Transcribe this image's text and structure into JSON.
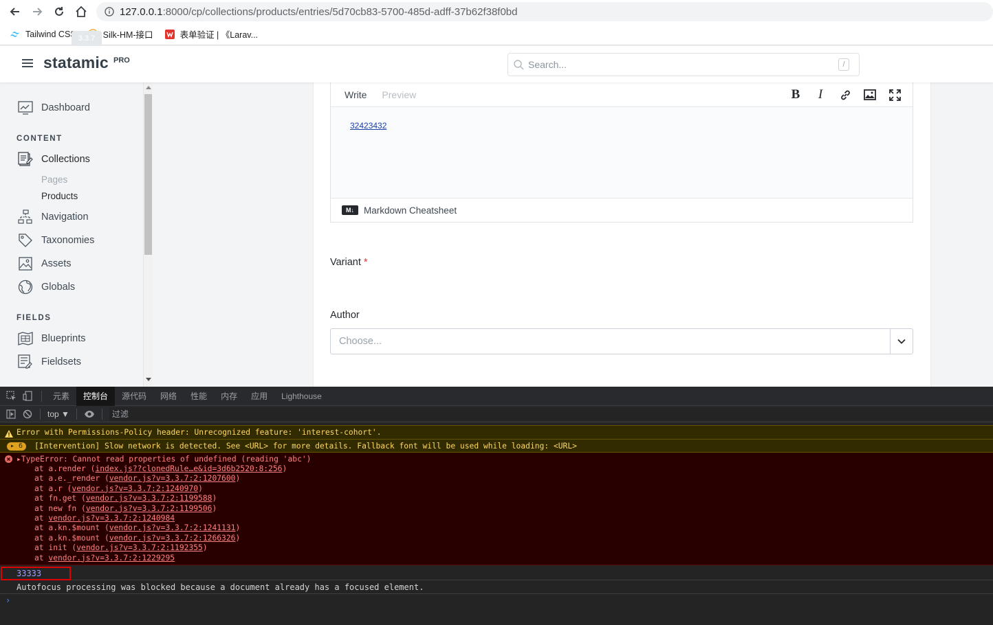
{
  "browser": {
    "url_host": "127.0.0.1",
    "url_path": ":8000/cp/collections/products/entries/5d70cb83-5700-485d-adff-37b62f38f0bd",
    "bookmarks": [
      {
        "label": "Tailwind CSS",
        "icon": "tailwind-icon"
      },
      {
        "label": "Silk-HM-接口",
        "icon": "yapi-icon"
      },
      {
        "label": "表单验证 | 《Larav...",
        "icon": "laravel-icon"
      }
    ]
  },
  "header": {
    "logo": "statamic",
    "logo_badge": "PRO",
    "version": "3.3.7",
    "search_placeholder": "Search...",
    "search_shortcut": "/"
  },
  "sidebar": {
    "dashboard": "Dashboard",
    "content_heading": "CONTENT",
    "collections": "Collections",
    "collections_children": [
      "Pages",
      "Products"
    ],
    "navigation": "Navigation",
    "taxonomies": "Taxonomies",
    "assets": "Assets",
    "globals": "Globals",
    "fields_heading": "FIELDS",
    "blueprints": "Blueprints",
    "fieldsets": "Fieldsets"
  },
  "editor": {
    "tab_write": "Write",
    "tab_preview": "Preview",
    "content_link": "32423432",
    "footer_badge": "M↓",
    "footer_label": "Markdown Cheatsheet"
  },
  "form": {
    "variant_label": "Variant",
    "required_mark": "*",
    "author_label": "Author",
    "author_placeholder": "Choose..."
  },
  "devtools": {
    "tabs": [
      "元素",
      "控制台",
      "源代码",
      "网络",
      "性能",
      "内存",
      "应用",
      "Lighthouse"
    ],
    "active_tab": "控制台",
    "context": "top ▼",
    "filter_placeholder": "过滤",
    "warning_1": "Error with Permissions-Policy header: Unrecognized feature: 'interest-cohort'.",
    "warning_2_count": "6",
    "warning_2": "[Intervention] Slow network is detected. See <URL> for more details. Fallback font will be used while loading: <URL>",
    "error_title": "▸TypeError: Cannot read properties of undefined (reading 'abc')",
    "stack": [
      {
        "prefix": "at a.render (",
        "link": "index.js??clonedRule…e&id=3d6b2520:8:256",
        "suffix": ")"
      },
      {
        "prefix": "at a.e._render (",
        "link": "vendor.js?v=3.3.7:2:1207600",
        "suffix": ")"
      },
      {
        "prefix": "at a.r (",
        "link": "vendor.js?v=3.3.7:2:1240970",
        "suffix": ")"
      },
      {
        "prefix": "at fn.get (",
        "link": "vendor.js?v=3.3.7:2:1199588",
        "suffix": ")"
      },
      {
        "prefix": "at new fn (",
        "link": "vendor.js?v=3.3.7:2:1199506",
        "suffix": ")"
      },
      {
        "prefix": "at ",
        "link": "vendor.js?v=3.3.7:2:1240984",
        "suffix": ""
      },
      {
        "prefix": "at a.kn.$mount (",
        "link": "vendor.js?v=3.3.7:2:1241131",
        "suffix": ")"
      },
      {
        "prefix": "at a.kn.$mount (",
        "link": "vendor.js?v=3.3.7:2:1266326",
        "suffix": ")"
      },
      {
        "prefix": "at init (",
        "link": "vendor.js?v=3.3.7:2:1192355",
        "suffix": ")"
      },
      {
        "prefix": "at ",
        "link": "vendor.js?v=3.3.7:2:1229295",
        "suffix": ""
      }
    ],
    "log_value": "33333",
    "log_autofocus": "Autofocus processing was blocked because a document already has a focused element.",
    "prompt": "›"
  }
}
